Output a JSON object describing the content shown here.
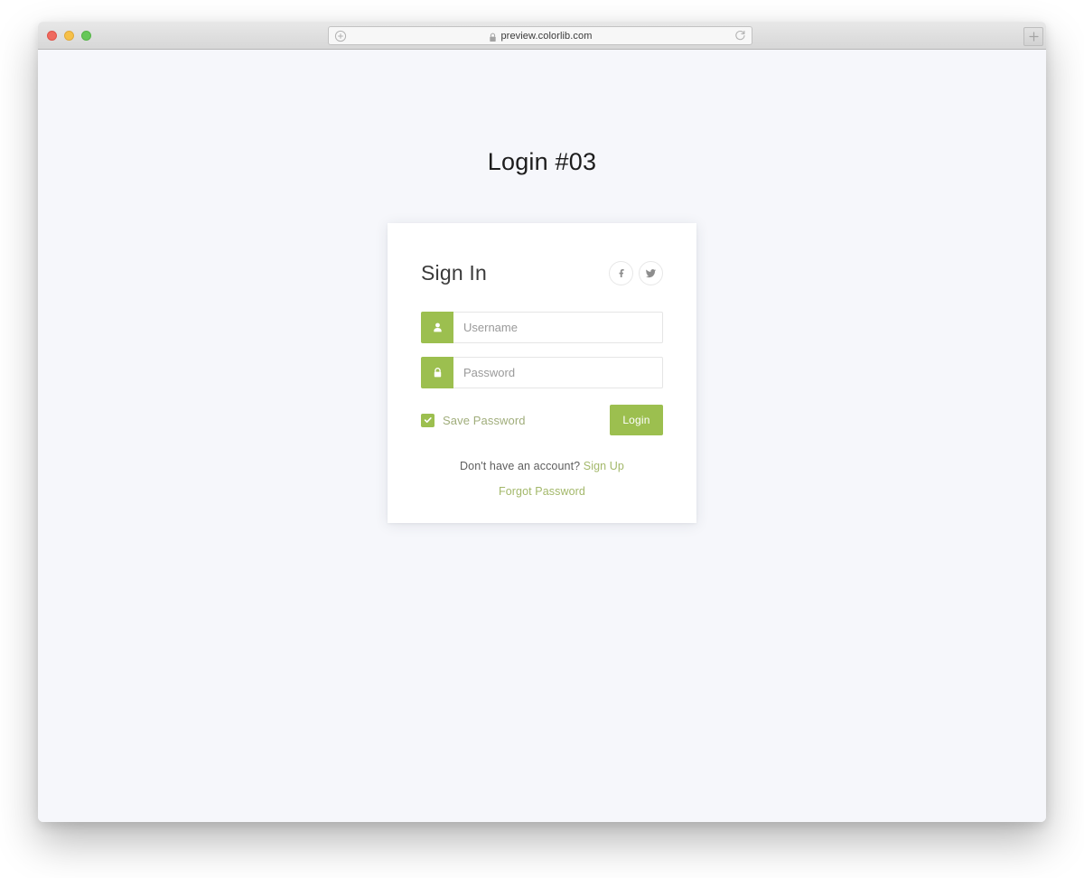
{
  "browser": {
    "url": "preview.colorlib.com",
    "lock_icon": "lock-icon",
    "left_icon": "compass-icon",
    "reload_icon": "reload-icon",
    "new_tab_icon": "plus-icon",
    "traffic_lights": [
      "close",
      "minimize",
      "maximize"
    ]
  },
  "page": {
    "title": "Login #03",
    "background_color": "#f6f7fb"
  },
  "card": {
    "heading": "Sign In",
    "accent_color": "#9cbf4f",
    "link_color": "#a3b86a",
    "social": [
      {
        "name": "facebook",
        "icon": "facebook-icon"
      },
      {
        "name": "twitter",
        "icon": "twitter-icon"
      }
    ],
    "fields": [
      {
        "name": "username",
        "icon": "user-icon",
        "placeholder": "Username",
        "value": "",
        "type": "text"
      },
      {
        "name": "password",
        "icon": "lock-icon",
        "placeholder": "Password",
        "value": "",
        "type": "password"
      }
    ],
    "save_password": {
      "label": "Save Password",
      "checked": true
    },
    "login_button": "Login",
    "footer": {
      "prompt": "Don't have an account?",
      "signup_label": "Sign Up",
      "forgot_label": "Forgot Password"
    }
  }
}
